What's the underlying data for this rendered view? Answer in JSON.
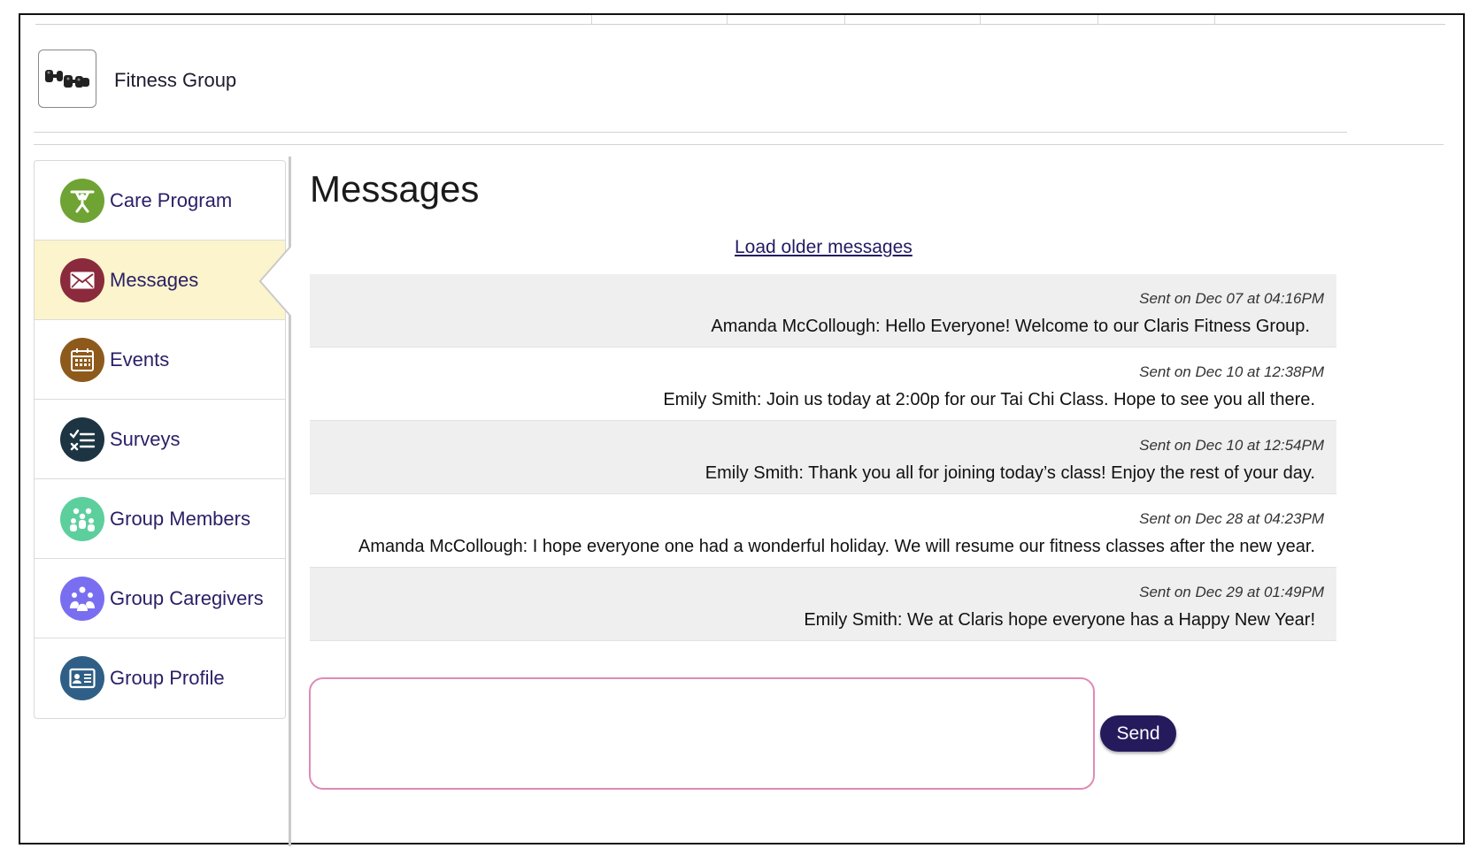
{
  "header": {
    "group_name": "Fitness Group",
    "logo_icon": "dumbbells-icon"
  },
  "sidebar": {
    "items": [
      {
        "label": "Care Program",
        "icon": "weightlifter-icon",
        "color": "#6fa334",
        "active": false
      },
      {
        "label": "Messages",
        "icon": "envelope-icon",
        "color": "#8a2a3c",
        "active": true
      },
      {
        "label": "Events",
        "icon": "calendar-icon",
        "color": "#8e5a1c",
        "active": false
      },
      {
        "label": "Surveys",
        "icon": "checklist-icon",
        "color": "#1d3442",
        "active": false
      },
      {
        "label": "Group Members",
        "icon": "people-group-icon",
        "color": "#5ccf9d",
        "active": false
      },
      {
        "label": "Group Caregivers",
        "icon": "caregivers-icon",
        "color": "#7a6ef0",
        "active": false
      },
      {
        "label": "Group Profile",
        "icon": "id-card-icon",
        "color": "#2f5f86",
        "active": false
      }
    ]
  },
  "main": {
    "title": "Messages",
    "load_older": "Load older messages",
    "messages": [
      {
        "timestamp": "Sent on Dec 07 at 04:16PM",
        "text": "Amanda McCollough: Hello Everyone! Welcome to our Claris Fitness Group."
      },
      {
        "timestamp": "Sent on Dec 10 at 12:38PM",
        "text": "Emily Smith: Join us today at 2:00p for our Tai Chi Class. Hope to see you all there."
      },
      {
        "timestamp": "Sent on Dec 10 at 12:54PM",
        "text": "Emily Smith: Thank you all for joining today’s class! Enjoy the rest of your day."
      },
      {
        "timestamp": "Sent on Dec 28 at 04:23PM",
        "text": "Amanda McCollough: I hope everyone one had a wonderful holiday. We will resume our fitness classes after the new year."
      },
      {
        "timestamp": "Sent on Dec 29 at 01:49PM",
        "text": "Emily Smith: We at Claris hope everyone has a Happy New Year!"
      }
    ]
  },
  "compose": {
    "value": "",
    "send_label": "Send"
  },
  "colors": {
    "accent": "#241a5c",
    "active_nav_bg": "#fbf4cc",
    "input_border": "#e08ab5"
  }
}
